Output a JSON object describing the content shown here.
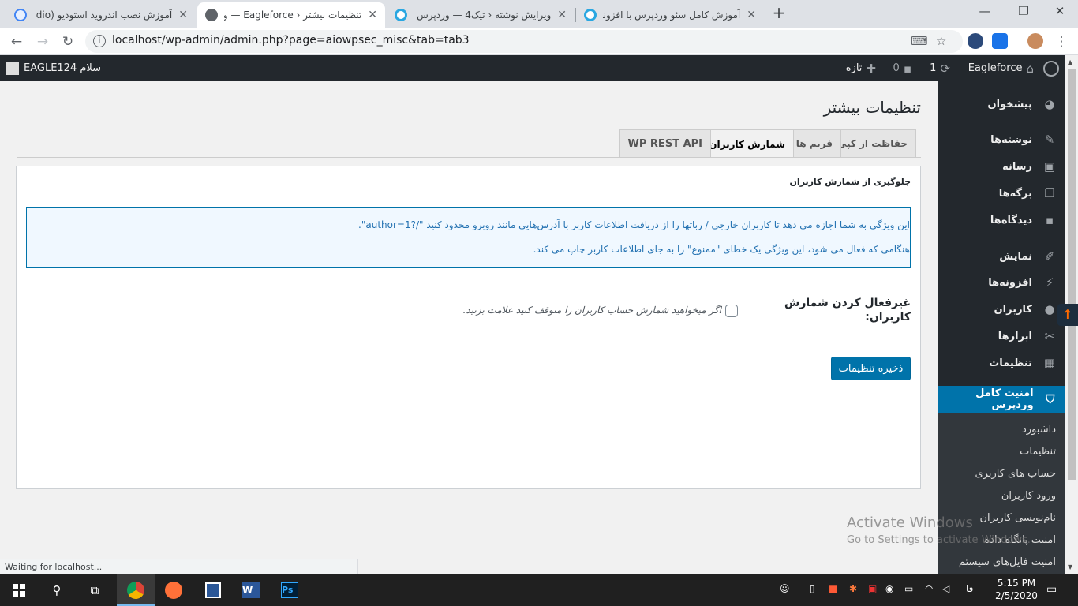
{
  "browser": {
    "tabs": [
      {
        "title": "آموزش نصب اندروید استودیو (dio",
        "active": false
      },
      {
        "title": "تنظیمات بیشتر ‹ Eagleforce — ورد",
        "active": true
      },
      {
        "title": "ویرایش نوشته ‹ تیک4 — وردپرس",
        "active": false
      },
      {
        "title": "آموزش کامل سئو وردپرس با افزونه",
        "active": false
      }
    ],
    "url": "localhost/wp-admin/admin.php?page=aiowpsec_misc&tab=tab3",
    "status_text": "Waiting for localhost..."
  },
  "adminbar": {
    "site_name": "Eagleforce",
    "updates_count": "1",
    "comments_count": "0",
    "new_label": "تازه",
    "greeting": "سلام EAGLE124"
  },
  "sidebar": {
    "items": [
      {
        "label": "پیشخوان",
        "icon": "dashboard-icon"
      },
      {
        "label": "نوشته‌ها",
        "icon": "pin-icon"
      },
      {
        "label": "رسانه",
        "icon": "media-icon"
      },
      {
        "label": "برگه‌ها",
        "icon": "pages-icon"
      },
      {
        "label": "دیدگاه‌ها",
        "icon": "comments-icon"
      },
      {
        "label": "نمایش",
        "icon": "appearance-icon"
      },
      {
        "label": "افزونه‌ها",
        "icon": "plugins-icon"
      },
      {
        "label": "کاربران",
        "icon": "users-icon"
      },
      {
        "label": "ابزارها",
        "icon": "tools-icon"
      },
      {
        "label": "تنظیمات",
        "icon": "settings-icon"
      },
      {
        "label": "امنیت کامل وردپرس",
        "icon": "shield-icon"
      }
    ],
    "submenu": [
      "داشبورد",
      "تنظیمات",
      "حساب های کاربری",
      "ورود کاربران",
      "نام‌نویسی کاربران",
      "امنیت پایگاه داده",
      "امنیت فایل‌های سیستم"
    ]
  },
  "page": {
    "title": "تنظیمات بیشتر",
    "tabs": [
      "حفاظت از کپی",
      "فریم ها",
      "شمارش کاربران",
      "WP REST API"
    ],
    "active_tab": "شمارش کاربران",
    "box_title": "جلوگیری از شمارش کاربران",
    "notice_line1": "این ویژگی به شما اجازه می دهد تا کاربران خارجی / رباتها را از دریافت اطلاعات کاربر با آدرس‌هایی مانند روبرو محدود کنید \"/?author=1\".",
    "notice_line2": "هنگامی که فعال می شود، این ویژگی یک خطای \"ممنوع\" را به جای اطلاعات کاربر چاپ می کند.",
    "field_label": "غیرفعال کردن شمارش کاربران:",
    "field_checked": false,
    "field_desc": "اگر میخواهید شمارش حساب کاربران را متوقف کنید علامت بزنید.",
    "save_label": "ذخیره تنظیمات"
  },
  "watermark": {
    "line1": "Activate Windows",
    "line2": "Go to Settings to activate Windows."
  },
  "taskbar": {
    "time": "5:15 PM",
    "date": "2/5/2020",
    "lang": "فا"
  },
  "colors": {
    "wp_blue": "#0073aa",
    "admin_dark": "#23282d"
  }
}
